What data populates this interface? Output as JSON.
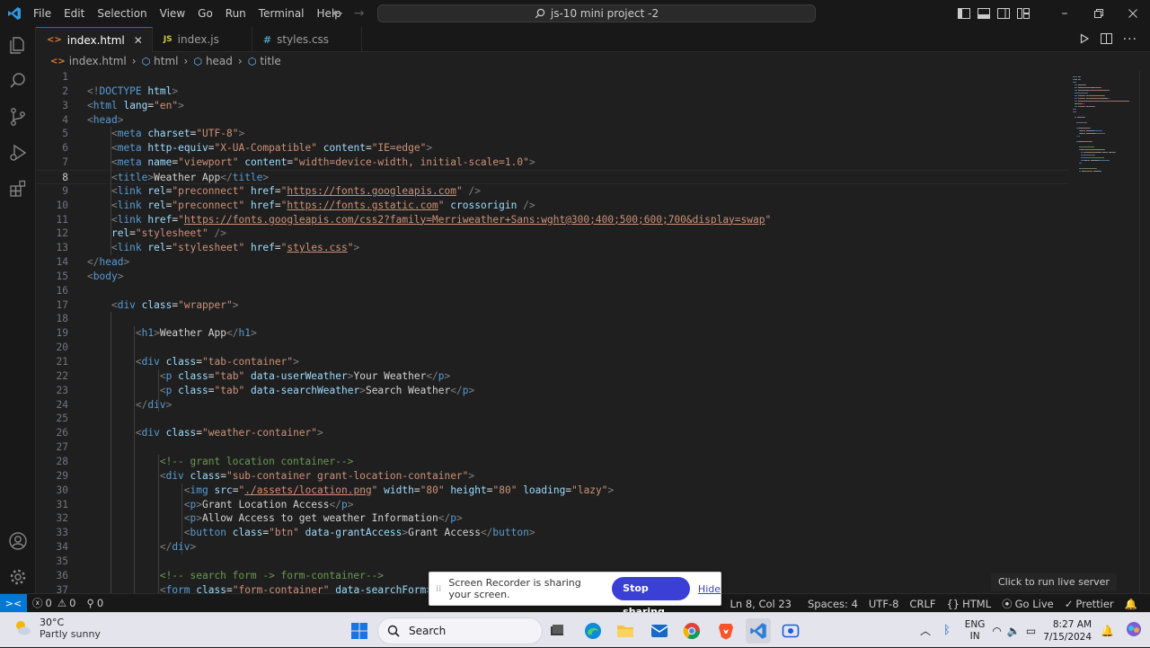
{
  "menu": [
    "File",
    "Edit",
    "Selection",
    "View",
    "Go",
    "Run",
    "Terminal",
    "Help"
  ],
  "command_center": "js-10 mini project -2",
  "tabs": [
    {
      "label": "index.html",
      "type": "html",
      "active": true
    },
    {
      "label": "index.js",
      "type": "js",
      "active": false
    },
    {
      "label": "styles.css",
      "type": "css",
      "active": false
    }
  ],
  "tab_type_icons": {
    "html": "<>",
    "js": "JS",
    "css": "#"
  },
  "breadcrumb": [
    "index.html",
    "html",
    "head",
    "title"
  ],
  "editor": {
    "current_line": 8,
    "lines": [
      [],
      [
        [
          "tag",
          "<!"
        ],
        [
          "name",
          "DOCTYPE"
        ],
        [
          "txt",
          " "
        ],
        [
          "attr",
          "html"
        ],
        [
          "tag",
          ">"
        ]
      ],
      [
        [
          "tag",
          "<"
        ],
        [
          "name",
          "html"
        ],
        [
          "txt",
          " "
        ],
        [
          "attr",
          "lang"
        ],
        [
          "txt",
          "="
        ],
        [
          "str",
          "\"en\""
        ],
        [
          "tag",
          ">"
        ]
      ],
      [
        [
          "tag",
          "<"
        ],
        [
          "name",
          "head"
        ],
        [
          "tag",
          ">"
        ]
      ],
      [
        [
          "txt",
          "    "
        ],
        [
          "tag",
          "<"
        ],
        [
          "name",
          "meta"
        ],
        [
          "txt",
          " "
        ],
        [
          "attr",
          "charset"
        ],
        [
          "txt",
          "="
        ],
        [
          "str",
          "\"UTF-8\""
        ],
        [
          "tag",
          ">"
        ]
      ],
      [
        [
          "txt",
          "    "
        ],
        [
          "tag",
          "<"
        ],
        [
          "name",
          "meta"
        ],
        [
          "txt",
          " "
        ],
        [
          "attr",
          "http-equiv"
        ],
        [
          "txt",
          "="
        ],
        [
          "str",
          "\"X-UA-Compatible\""
        ],
        [
          "txt",
          " "
        ],
        [
          "attr",
          "content"
        ],
        [
          "txt",
          "="
        ],
        [
          "str",
          "\"IE=edge\""
        ],
        [
          "tag",
          ">"
        ]
      ],
      [
        [
          "txt",
          "    "
        ],
        [
          "tag",
          "<"
        ],
        [
          "name",
          "meta"
        ],
        [
          "txt",
          " "
        ],
        [
          "attr",
          "name"
        ],
        [
          "txt",
          "="
        ],
        [
          "str",
          "\"viewport\""
        ],
        [
          "txt",
          " "
        ],
        [
          "attr",
          "content"
        ],
        [
          "txt",
          "="
        ],
        [
          "str",
          "\"width=device-width, initial-scale=1.0\""
        ],
        [
          "tag",
          ">"
        ]
      ],
      [
        [
          "txt",
          "    "
        ],
        [
          "tag",
          "<"
        ],
        [
          "name",
          "title"
        ],
        [
          "tag",
          ">"
        ],
        [
          "txt",
          "Weather App"
        ],
        [
          "tag",
          "</"
        ],
        [
          "name",
          "title"
        ],
        [
          "tag",
          ">"
        ]
      ],
      [
        [
          "txt",
          "    "
        ],
        [
          "tag",
          "<"
        ],
        [
          "name",
          "link"
        ],
        [
          "txt",
          " "
        ],
        [
          "attr",
          "rel"
        ],
        [
          "txt",
          "="
        ],
        [
          "str",
          "\"preconnect\""
        ],
        [
          "txt",
          " "
        ],
        [
          "attr",
          "href"
        ],
        [
          "txt",
          "="
        ],
        [
          "str",
          "\""
        ],
        [
          "link",
          "https://fonts.googleapis.com"
        ],
        [
          "str",
          "\""
        ],
        [
          "txt",
          " "
        ],
        [
          "tag",
          "/>"
        ]
      ],
      [
        [
          "txt",
          "    "
        ],
        [
          "tag",
          "<"
        ],
        [
          "name",
          "link"
        ],
        [
          "txt",
          " "
        ],
        [
          "attr",
          "rel"
        ],
        [
          "txt",
          "="
        ],
        [
          "str",
          "\"preconnect\""
        ],
        [
          "txt",
          " "
        ],
        [
          "attr",
          "href"
        ],
        [
          "txt",
          "="
        ],
        [
          "str",
          "\""
        ],
        [
          "link",
          "https://fonts.gstatic.com"
        ],
        [
          "str",
          "\""
        ],
        [
          "txt",
          " "
        ],
        [
          "attr",
          "crossorigin"
        ],
        [
          "txt",
          " "
        ],
        [
          "tag",
          "/>"
        ]
      ],
      [
        [
          "txt",
          "    "
        ],
        [
          "tag",
          "<"
        ],
        [
          "name",
          "link"
        ],
        [
          "txt",
          " "
        ],
        [
          "attr",
          "href"
        ],
        [
          "txt",
          "="
        ],
        [
          "str",
          "\""
        ],
        [
          "link",
          "https://fonts.googleapis.com/css2?family=Merriweather+Sans:wght@300;400;500;600;700&display=swap"
        ],
        [
          "str",
          "\""
        ]
      ],
      [
        [
          "txt",
          "    "
        ],
        [
          "attr",
          "rel"
        ],
        [
          "txt",
          "="
        ],
        [
          "str",
          "\"stylesheet\""
        ],
        [
          "txt",
          " "
        ],
        [
          "tag",
          "/>"
        ]
      ],
      [
        [
          "txt",
          "    "
        ],
        [
          "tag",
          "<"
        ],
        [
          "name",
          "link"
        ],
        [
          "txt",
          " "
        ],
        [
          "attr",
          "rel"
        ],
        [
          "txt",
          "="
        ],
        [
          "str",
          "\"stylesheet\""
        ],
        [
          "txt",
          " "
        ],
        [
          "attr",
          "href"
        ],
        [
          "txt",
          "="
        ],
        [
          "str",
          "\""
        ],
        [
          "link",
          "styles.css"
        ],
        [
          "str",
          "\""
        ],
        [
          "tag",
          ">"
        ]
      ],
      [
        [
          "tag",
          "</"
        ],
        [
          "name",
          "head"
        ],
        [
          "tag",
          ">"
        ]
      ],
      [
        [
          "tag",
          "<"
        ],
        [
          "name",
          "body"
        ],
        [
          "tag",
          ">"
        ]
      ],
      [],
      [
        [
          "txt",
          "    "
        ],
        [
          "tag",
          "<"
        ],
        [
          "name",
          "div"
        ],
        [
          "txt",
          " "
        ],
        [
          "attr",
          "class"
        ],
        [
          "txt",
          "="
        ],
        [
          "str",
          "\"wrapper\""
        ],
        [
          "tag",
          ">"
        ]
      ],
      [],
      [
        [
          "txt",
          "        "
        ],
        [
          "tag",
          "<"
        ],
        [
          "name",
          "h1"
        ],
        [
          "tag",
          ">"
        ],
        [
          "txt",
          "Weather App"
        ],
        [
          "tag",
          "</"
        ],
        [
          "name",
          "h1"
        ],
        [
          "tag",
          ">"
        ]
      ],
      [],
      [
        [
          "txt",
          "        "
        ],
        [
          "tag",
          "<"
        ],
        [
          "name",
          "div"
        ],
        [
          "txt",
          " "
        ],
        [
          "attr",
          "class"
        ],
        [
          "txt",
          "="
        ],
        [
          "str",
          "\"tab-container\""
        ],
        [
          "tag",
          ">"
        ]
      ],
      [
        [
          "txt",
          "            "
        ],
        [
          "tag",
          "<"
        ],
        [
          "name",
          "p"
        ],
        [
          "txt",
          " "
        ],
        [
          "attr",
          "class"
        ],
        [
          "txt",
          "="
        ],
        [
          "str",
          "\"tab\""
        ],
        [
          "txt",
          " "
        ],
        [
          "attr",
          "data-userWeather"
        ],
        [
          "tag",
          ">"
        ],
        [
          "txt",
          "Your Weather"
        ],
        [
          "tag",
          "</"
        ],
        [
          "name",
          "p"
        ],
        [
          "tag",
          ">"
        ]
      ],
      [
        [
          "txt",
          "            "
        ],
        [
          "tag",
          "<"
        ],
        [
          "name",
          "p"
        ],
        [
          "txt",
          " "
        ],
        [
          "attr",
          "class"
        ],
        [
          "txt",
          "="
        ],
        [
          "str",
          "\"tab\""
        ],
        [
          "txt",
          " "
        ],
        [
          "attr",
          "data-searchWeather"
        ],
        [
          "tag",
          ">"
        ],
        [
          "txt",
          "Search Weather"
        ],
        [
          "tag",
          "</"
        ],
        [
          "name",
          "p"
        ],
        [
          "tag",
          ">"
        ]
      ],
      [
        [
          "txt",
          "        "
        ],
        [
          "tag",
          "</"
        ],
        [
          "name",
          "div"
        ],
        [
          "tag",
          ">"
        ]
      ],
      [],
      [
        [
          "txt",
          "        "
        ],
        [
          "tag",
          "<"
        ],
        [
          "name",
          "div"
        ],
        [
          "txt",
          " "
        ],
        [
          "attr",
          "class"
        ],
        [
          "txt",
          "="
        ],
        [
          "str",
          "\"weather-container\""
        ],
        [
          "tag",
          ">"
        ]
      ],
      [],
      [
        [
          "txt",
          "            "
        ],
        [
          "cmt",
          "<!-- grant location container-->"
        ]
      ],
      [
        [
          "txt",
          "            "
        ],
        [
          "tag",
          "<"
        ],
        [
          "name",
          "div"
        ],
        [
          "txt",
          " "
        ],
        [
          "attr",
          "class"
        ],
        [
          "txt",
          "="
        ],
        [
          "str",
          "\"sub-container grant-location-container\""
        ],
        [
          "tag",
          ">"
        ]
      ],
      [
        [
          "txt",
          "                "
        ],
        [
          "tag",
          "<"
        ],
        [
          "name",
          "img"
        ],
        [
          "txt",
          " "
        ],
        [
          "attr",
          "src"
        ],
        [
          "txt",
          "="
        ],
        [
          "str",
          "\""
        ],
        [
          "link",
          "./assets/location.png"
        ],
        [
          "str",
          "\""
        ],
        [
          "txt",
          " "
        ],
        [
          "attr",
          "width"
        ],
        [
          "txt",
          "="
        ],
        [
          "str",
          "\"80\""
        ],
        [
          "txt",
          " "
        ],
        [
          "attr",
          "height"
        ],
        [
          "txt",
          "="
        ],
        [
          "str",
          "\"80\""
        ],
        [
          "txt",
          " "
        ],
        [
          "attr",
          "loading"
        ],
        [
          "txt",
          "="
        ],
        [
          "str",
          "\"lazy\""
        ],
        [
          "tag",
          ">"
        ]
      ],
      [
        [
          "txt",
          "                "
        ],
        [
          "tag",
          "<"
        ],
        [
          "name",
          "p"
        ],
        [
          "tag",
          ">"
        ],
        [
          "txt",
          "Grant Location Access"
        ],
        [
          "tag",
          "</"
        ],
        [
          "name",
          "p"
        ],
        [
          "tag",
          ">"
        ]
      ],
      [
        [
          "txt",
          "                "
        ],
        [
          "tag",
          "<"
        ],
        [
          "name",
          "p"
        ],
        [
          "tag",
          ">"
        ],
        [
          "txt",
          "Allow Access to get weather Information"
        ],
        [
          "tag",
          "</"
        ],
        [
          "name",
          "p"
        ],
        [
          "tag",
          ">"
        ]
      ],
      [
        [
          "txt",
          "                "
        ],
        [
          "tag",
          "<"
        ],
        [
          "name",
          "button"
        ],
        [
          "txt",
          " "
        ],
        [
          "attr",
          "class"
        ],
        [
          "txt",
          "="
        ],
        [
          "str",
          "\"btn\""
        ],
        [
          "txt",
          " "
        ],
        [
          "attr",
          "data-grantAccess"
        ],
        [
          "tag",
          ">"
        ],
        [
          "txt",
          "Grant Access"
        ],
        [
          "tag",
          "</"
        ],
        [
          "name",
          "button"
        ],
        [
          "tag",
          ">"
        ]
      ],
      [
        [
          "txt",
          "            "
        ],
        [
          "tag",
          "</"
        ],
        [
          "name",
          "div"
        ],
        [
          "tag",
          ">"
        ]
      ],
      [],
      [
        [
          "txt",
          "            "
        ],
        [
          "cmt",
          "<!-- search form -> form-container-->"
        ]
      ],
      [
        [
          "txt",
          "            "
        ],
        [
          "tag",
          "<"
        ],
        [
          "name",
          "form"
        ],
        [
          "txt",
          " "
        ],
        [
          "attr",
          "class"
        ],
        [
          "txt",
          "="
        ],
        [
          "str",
          "\"form-container\""
        ],
        [
          "txt",
          " "
        ],
        [
          "attr",
          "data-searchForm"
        ],
        [
          "tag",
          ">"
        ]
      ]
    ]
  },
  "statusbar": {
    "errors": "0",
    "warnings": "0",
    "ports": "0",
    "cursor": "Ln 8, Col 23",
    "spaces": "Spaces: 4",
    "encoding": "UTF-8",
    "eol": "CRLF",
    "language": "HTML",
    "go_live": "Go Live",
    "prettier": "Prettier"
  },
  "tooltip": "Click to run live server",
  "share_banner": {
    "text": "Screen Recorder is sharing your screen.",
    "stop": "Stop sharing",
    "hide": "Hide"
  },
  "taskbar": {
    "temperature": "30°C",
    "condition": "Partly sunny",
    "search_placeholder": "Search",
    "lang_top": "ENG",
    "lang_bottom": "IN",
    "time": "8:27 AM",
    "date": "7/15/2024"
  },
  "colors": {
    "accent": "#0078d4",
    "editor_bg": "#1f1f1f",
    "chrome_bg": "#181818",
    "stop_sharing": "#3a3fd6"
  }
}
